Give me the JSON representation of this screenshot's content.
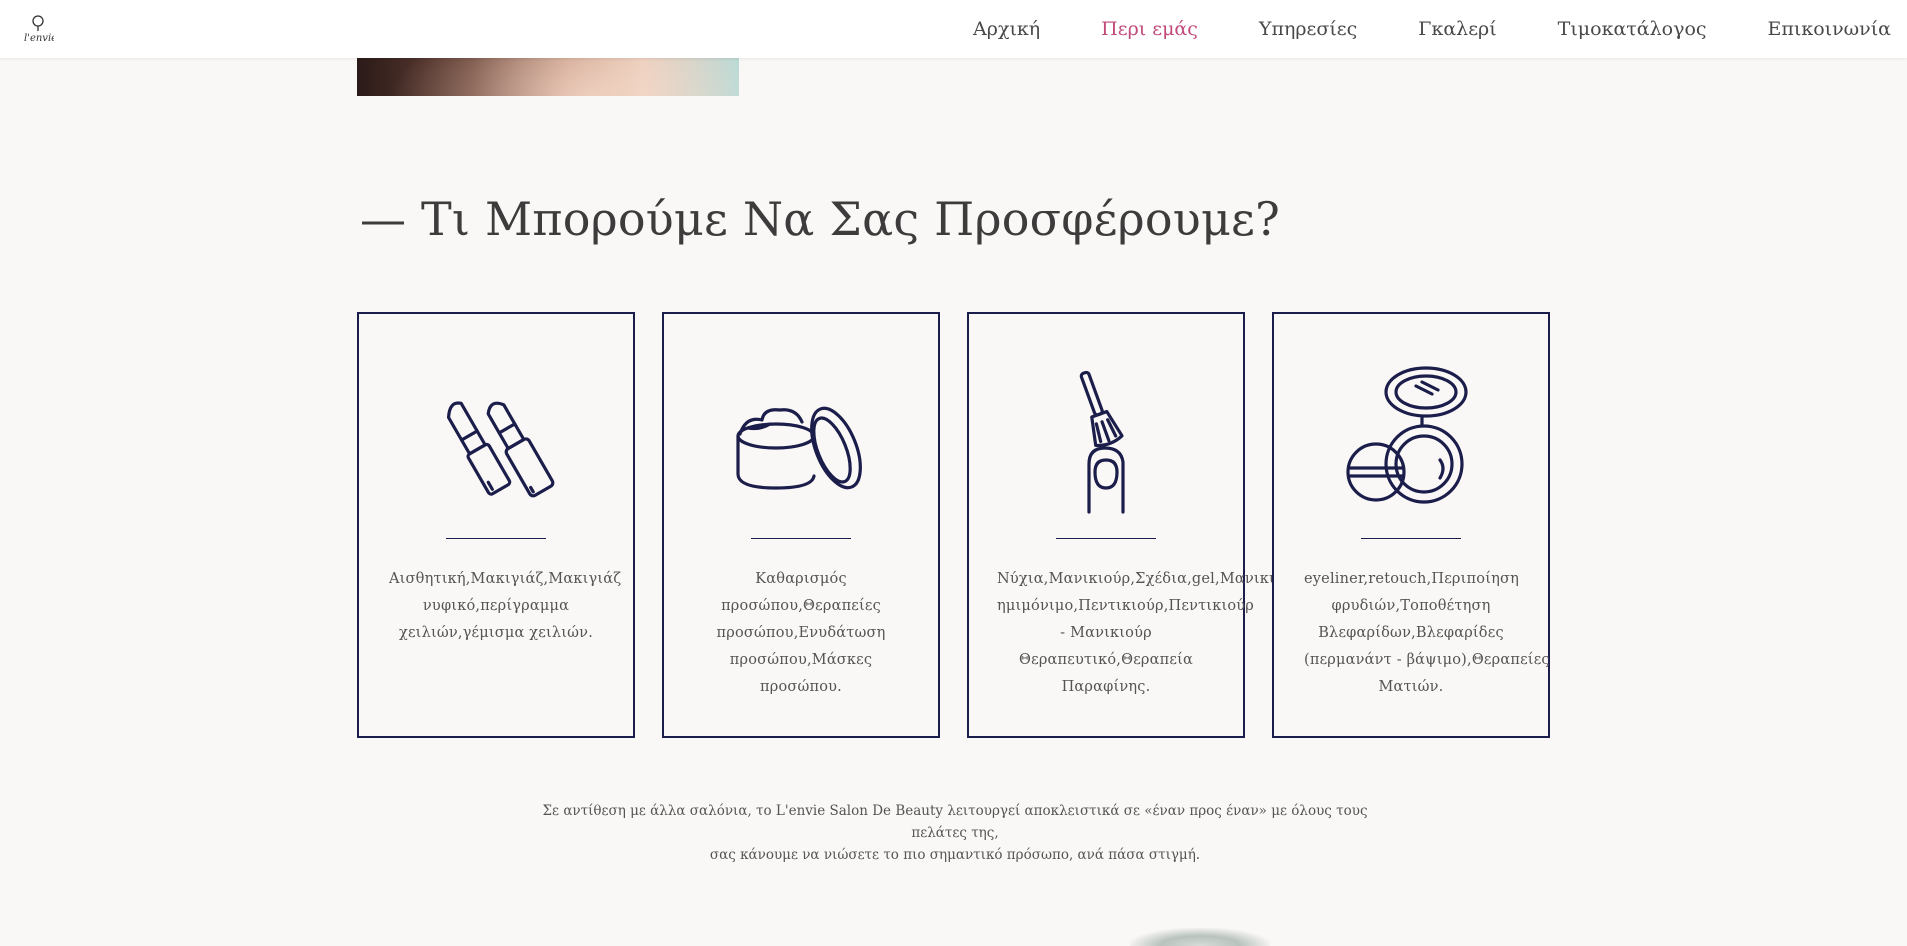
{
  "header": {
    "logo_alt": "L'envie",
    "nav": [
      {
        "label": "Αρχική",
        "active": false
      },
      {
        "label": "Περι εμάς",
        "active": true
      },
      {
        "label": "Υπηρεσίες",
        "active": false
      },
      {
        "label": "Γκαλερί",
        "active": false
      },
      {
        "label": "Τιμοκατάλογος",
        "active": false
      },
      {
        "label": "Επικοινωνία",
        "active": false
      }
    ]
  },
  "section": {
    "title": "— Τι Μπορούμε Να Σας Προσφέρουμε?"
  },
  "cards": [
    {
      "icon": "lipstick-icon",
      "lines": [
        "Αισθητική,Μακιγιάζ,Μακιγιάζ",
        "νυφικό,περίγραμμα",
        "χειλιών,γέμισμα χειλιών."
      ]
    },
    {
      "icon": "cream-jar-icon",
      "lines": [
        "Καθαρισμός",
        "προσώπου,Θεραπείες",
        "προσώπου,Ενυδάτωση",
        "προσώπου,Μάσκες προσώπου."
      ]
    },
    {
      "icon": "nail-polish-icon",
      "lines": [
        "Νύχια,Μανικιούρ,Σχέδια,gel,Μανικιούρ",
        "ημιμόνιμο,Πεντικιούρ,Πεντικιούρ",
        "- Μανικιούρ",
        "Θεραπευτικό,Θεραπεία",
        "Παραφίνης."
      ]
    },
    {
      "icon": "compact-powder-icon",
      "lines": [
        "eyeliner,retouch,Περιποίηση",
        "φρυδιών,Τοποθέτηση",
        "Βλεφαρίδων,Βλεφαρίδες",
        "(περμανάντ - βάψιμο),Θεραπείες",
        "Ματιών."
      ]
    }
  ],
  "intro": {
    "line1": "Σε αντίθεση με άλλα σαλόνια, το L'envie Salon De Beauty λειτουργεί αποκλειστικά σε «έναν προς έναν» με όλους τους πελάτες της,",
    "line2": "σας κάνουμε να νιώσετε το πιο σημαντικό πρόσωπο, ανά πάσα στιγμή."
  },
  "colors": {
    "accent": "#c2497a",
    "icon_stroke": "#1b1d4a",
    "background": "#faf8f6",
    "text": "#4a4848"
  }
}
